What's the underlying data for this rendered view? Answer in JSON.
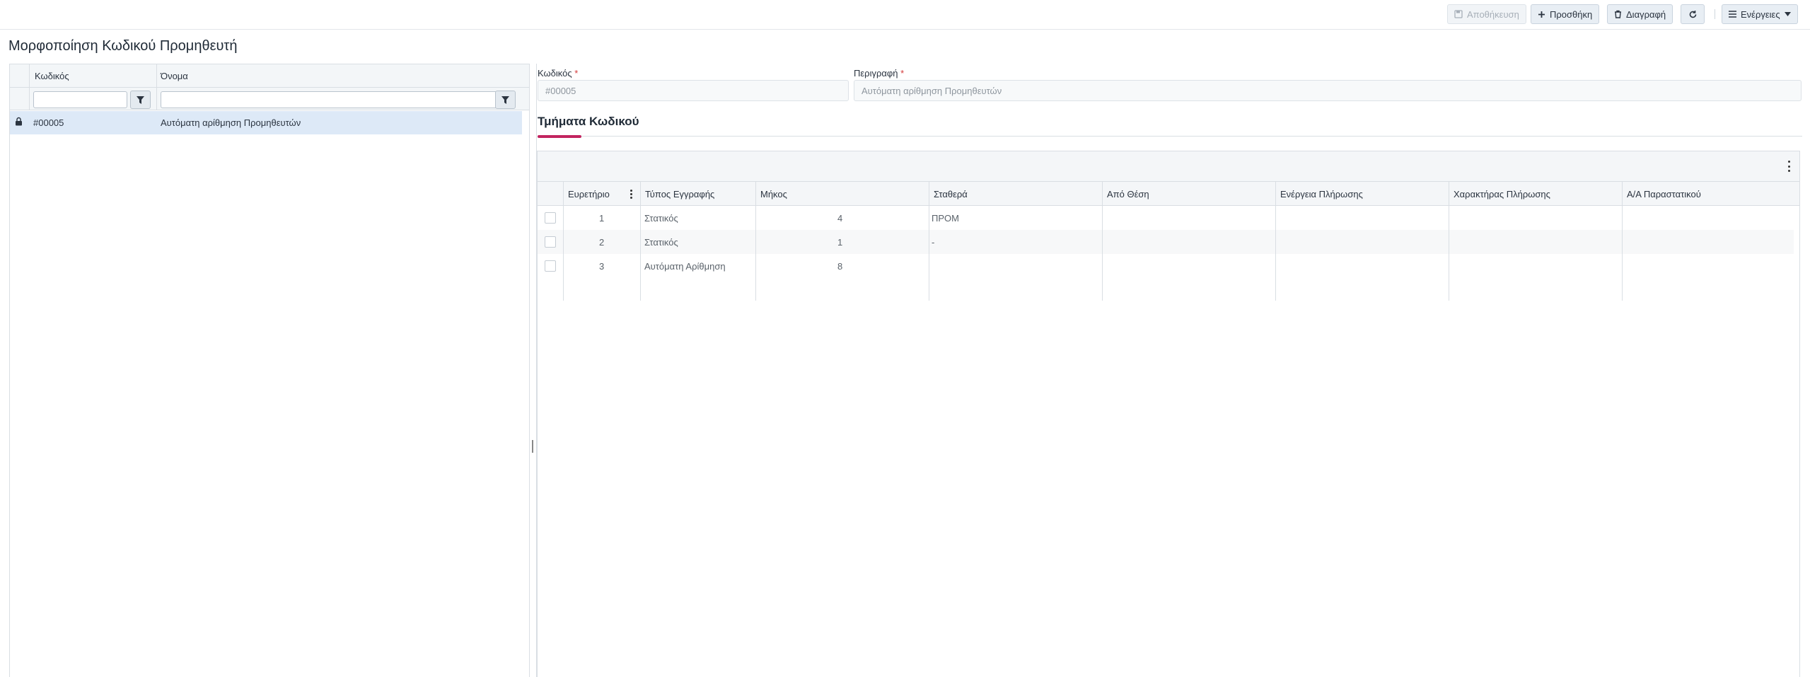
{
  "toolbar": {
    "save_label": "Αποθήκευση",
    "add_label": "Προσθήκη",
    "delete_label": "Διαγραφή",
    "actions_label": "Ενέργειες"
  },
  "page": {
    "title": "Μορφοποίηση Κωδικού Προμηθευτή"
  },
  "left_grid": {
    "columns": [
      "Κωδικός",
      "Όνομα"
    ],
    "rows": [
      {
        "code": "#00005",
        "name": "Αυτόματη αρίθμηση Προμηθευτών",
        "selected": true
      }
    ]
  },
  "form": {
    "code_label": "Κωδικός",
    "code_value": "#00005",
    "description_label": "Περιγραφή",
    "description_value": "Αυτόματη αρίθμηση Προμηθευτών",
    "required_mark": "*"
  },
  "section": {
    "title": "Τμήματα Κωδικού"
  },
  "parts_grid": {
    "columns": [
      "Ευρετήριο",
      "Τύπος Εγγραφής",
      "Μήκος",
      "Σταθερά",
      "Από Θέση",
      "Ενέργεια Πλήρωσης",
      "Χαρακτήρας Πλήρωσης",
      "Α/Α Παραστατικού"
    ],
    "rows": [
      {
        "index": "1",
        "type": "Στατικός",
        "length": "4",
        "constant": "ΠΡΟΜ",
        "from": "",
        "fill_action": "",
        "fill_char": "",
        "doc_no": ""
      },
      {
        "index": "2",
        "type": "Στατικός",
        "length": "1",
        "constant": "-",
        "from": "",
        "fill_action": "",
        "fill_char": "",
        "doc_no": ""
      },
      {
        "index": "3",
        "type": "Αυτόματη Αρίθμηση",
        "length": "8",
        "constant": "",
        "from": "",
        "fill_action": "",
        "fill_char": "",
        "doc_no": ""
      }
    ]
  },
  "colors": {
    "accent": "#c2245f",
    "selected_row": "#dde9f7",
    "required": "#d43a3a"
  }
}
